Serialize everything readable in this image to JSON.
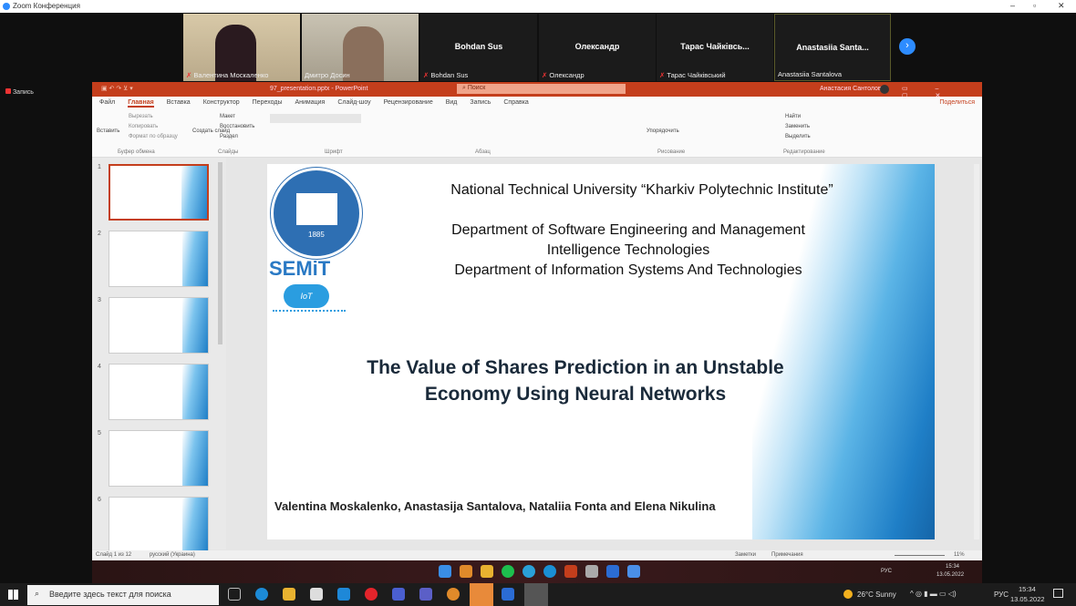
{
  "zoom": {
    "title": "Zoom Конференция",
    "record_label": "Запись",
    "participants": [
      {
        "name": "Валентина Москаленко",
        "video": true
      },
      {
        "name": "Дмитро Досин",
        "video": true
      },
      {
        "display": "Bohdan Sus",
        "name": "Bohdan Sus"
      },
      {
        "display": "Олександр",
        "name": "Олександр"
      },
      {
        "display": "Тарас Чайківсь...",
        "name": "Тарас Чайківський"
      },
      {
        "display": "Anastasiia Santa...",
        "name": "Anastasiia Santalova"
      }
    ]
  },
  "ppt": {
    "title": "97_presentation.pptx - PowerPoint",
    "search": "Поиск",
    "user": "Анастасия Сантолова",
    "tabs": [
      "Файл",
      "Главная",
      "Вставка",
      "Конструктор",
      "Переходы",
      "Анимация",
      "Слайд-шоу",
      "Рецензирование",
      "Вид",
      "Запись",
      "Справка"
    ],
    "share": "Поделиться",
    "groups": [
      "Буфер обмена",
      "Слайды",
      "Шрифт",
      "Абзац",
      "Рисование",
      "Редактирование"
    ],
    "ribbon_items": {
      "paste": "Вставить",
      "cut": "Вырезать",
      "copy": "Копировать",
      "format": "Формат по образцу",
      "new_slide": "Создать слайд",
      "layout": "Макет",
      "reset": "Восстановить",
      "section": "Раздел",
      "arrange": "Упорядочить",
      "find": "Найти",
      "replace": "Заменить",
      "select": "Выделить"
    },
    "slide_numbers": [
      "1",
      "2",
      "3",
      "4",
      "5",
      "6"
    ],
    "status": {
      "slide": "Слайд 1 из 12",
      "lang": "русский (Украина)",
      "notes": "Заметки",
      "comments": "Примечания",
      "zoom": "11%"
    }
  },
  "slide": {
    "university": "National Technical University “Kharkiv Polytechnic Institute”",
    "dept1": "Department of Software Engineering and Management",
    "dept1b": "Intelligence Technologies",
    "dept2": "Department of Information Systems And Technologies",
    "title1": "The Value of Shares Prediction in an Unstable",
    "title2": "Economy Using Neural Networks",
    "authors": "Valentina Moskalenko, Anastasija Santalova, Nataliia Fonta and Elena Nikulina",
    "logo_text": "KHARKIV POLYTECHNIC INSTITUTE",
    "logo_year": "1885",
    "logo_ntu": "NTU",
    "semit": "SEMiT",
    "iot": "IoT"
  },
  "inner_taskbar": {
    "lang": "РУС",
    "time": "15:34",
    "date": "13.05.2022"
  },
  "taskbar": {
    "search_placeholder": "Введите здесь текст для поиска",
    "weather": "26°C  Sunny",
    "lang": "РУС",
    "time": "15:34",
    "date": "13.05.2022"
  }
}
